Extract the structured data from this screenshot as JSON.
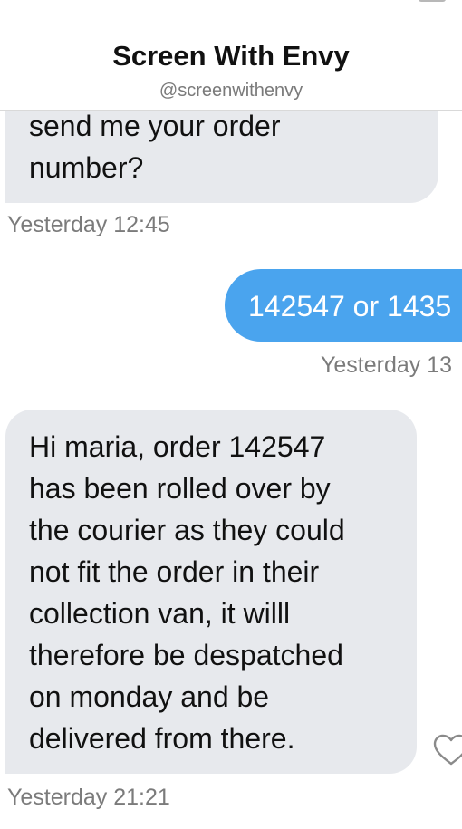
{
  "header": {
    "title": "Screen With Envy",
    "handle": "@screenwithenvy"
  },
  "messages": [
    {
      "direction": "incoming",
      "lines": [
        "send me your order",
        "number?"
      ],
      "timestamp": "Yesterday 12:45"
    },
    {
      "direction": "outgoing",
      "lines": [
        "142547 or 1435"
      ],
      "timestamp": "Yesterday 13"
    },
    {
      "direction": "incoming",
      "lines": [
        "Hi maria, order 142547",
        "has been rolled over by",
        "the courier as they could",
        "not fit the order in their",
        "collection van, it willl",
        "therefore be despatched",
        "on monday and be",
        "delivered from there."
      ],
      "timestamp": "Yesterday 21:21"
    }
  ],
  "icons": {
    "like": "heart-outline-icon"
  },
  "colors": {
    "incoming_bubble": "#e7e9ed",
    "outgoing_bubble": "#4aa4ee",
    "timestamp_text": "#7b7b7b"
  }
}
